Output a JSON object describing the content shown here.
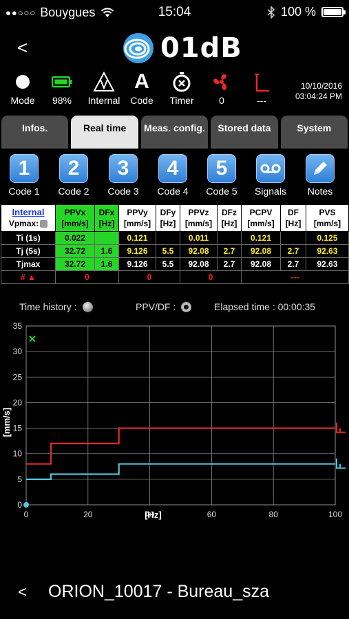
{
  "status_bar": {
    "signal_dots": "●●○○○",
    "carrier": "Bouygues",
    "time": "15:04",
    "bluetooth_icon": "bluetooth-icon",
    "battery_text": "100 %",
    "battery_level": 1.0
  },
  "header": {
    "back_label": "<",
    "logo_text": "01dB"
  },
  "indicators": [
    {
      "icon": "mode-dot-icon",
      "label": "Mode"
    },
    {
      "icon": "battery-green-icon",
      "label": "98%"
    },
    {
      "icon": "internal-trigger-icon",
      "label": "Internal"
    },
    {
      "icon": "code-letter-icon",
      "glyph": "A",
      "label": "Code"
    },
    {
      "icon": "timer-icon",
      "label": "Timer"
    },
    {
      "icon": "fan-icon",
      "label": "0"
    },
    {
      "icon": "trigger-red-icon",
      "label": "---"
    }
  ],
  "datetime": {
    "date": "10/10/2016",
    "time": "03:04:24 PM"
  },
  "tabs": [
    {
      "label": "Infos.",
      "active": false
    },
    {
      "label": "Real time",
      "active": true
    },
    {
      "label": "Meas. config.",
      "active": false
    },
    {
      "label": "Stored data",
      "active": false
    },
    {
      "label": "System",
      "active": false
    }
  ],
  "codes": [
    {
      "glyph": "1",
      "label": "Code 1"
    },
    {
      "glyph": "2",
      "label": "Code 2"
    },
    {
      "glyph": "3",
      "label": "Code 3"
    },
    {
      "glyph": "4",
      "label": "Code 4"
    },
    {
      "glyph": "5",
      "label": "Code 5"
    },
    {
      "glyph": "voicemail",
      "label": "Signals"
    },
    {
      "glyph": "pencil",
      "label": "Notes"
    }
  ],
  "table": {
    "corner_link": "Internal",
    "corner_label": "Vpmax:",
    "headers": [
      {
        "top": "PPVx",
        "unit": "[mm/s]"
      },
      {
        "top": "DFx",
        "unit": "[Hz]"
      },
      {
        "top": "PPVy",
        "unit": "[mm/s]"
      },
      {
        "top": "DFy",
        "unit": "[Hz]"
      },
      {
        "top": "PPVz",
        "unit": "[mm/s]"
      },
      {
        "top": "DFz",
        "unit": "[Hz]"
      },
      {
        "top": "PCPV",
        "unit": "[mm/s]"
      },
      {
        "top": "DF",
        "unit": "[Hz]"
      },
      {
        "top": "PVS",
        "unit": "[mm/s]"
      }
    ],
    "rows": [
      {
        "label": "Ti (1s)",
        "cells": [
          "0.022",
          "",
          "0.121",
          "",
          "0.011",
          "",
          "0.121",
          "",
          "0.125"
        ]
      },
      {
        "label": "Tj (5s)",
        "cells": [
          "32.72",
          "1.6",
          "9.126",
          "5.5",
          "92.08",
          "2.7",
          "92.08",
          "2.7",
          "92.63"
        ]
      },
      {
        "label": "Tjmax",
        "cells": [
          "32.72",
          "1.6",
          "9.126",
          "5.5",
          "92.08",
          "2.7",
          "92.08",
          "2.7",
          "92.63"
        ]
      }
    ],
    "alarm_row": {
      "label": "# ▲",
      "values": [
        "0",
        "0",
        "0",
        "---"
      ]
    }
  },
  "chart_header": {
    "time_history_label": "Time history :",
    "ppv_df_label": "PPV/DF :",
    "elapsed_label": "Elapsed time : 00:00:35"
  },
  "chart_data": {
    "type": "line",
    "xlabel": "[Hz]",
    "ylabel": "[mm/s]",
    "xlim": [
      0,
      100
    ],
    "ylim": [
      0,
      35
    ],
    "xticks": [
      0,
      20,
      40,
      60,
      80,
      100
    ],
    "yticks": [
      0,
      5,
      10,
      15,
      20,
      25,
      30,
      35
    ],
    "grid": true,
    "series": [
      {
        "color": "#e8282a",
        "x": [
          0,
          8,
          8,
          30,
          30,
          100
        ],
        "y": [
          8,
          8,
          12,
          12,
          15,
          15
        ]
      },
      {
        "color": "#4ec7de",
        "x": [
          0,
          8,
          8,
          30,
          30,
          100
        ],
        "y": [
          5,
          5,
          6,
          6,
          8,
          8
        ]
      }
    ],
    "points": [
      {
        "color": "#27d527",
        "marker": "x",
        "x": 2,
        "y": 32.5
      },
      {
        "color": "#4ec7de",
        "marker": "dot",
        "x": 0,
        "y": 0
      }
    ]
  },
  "footer": {
    "back_label": "<",
    "device_name": "ORION_10017 - Bureau_sza"
  }
}
